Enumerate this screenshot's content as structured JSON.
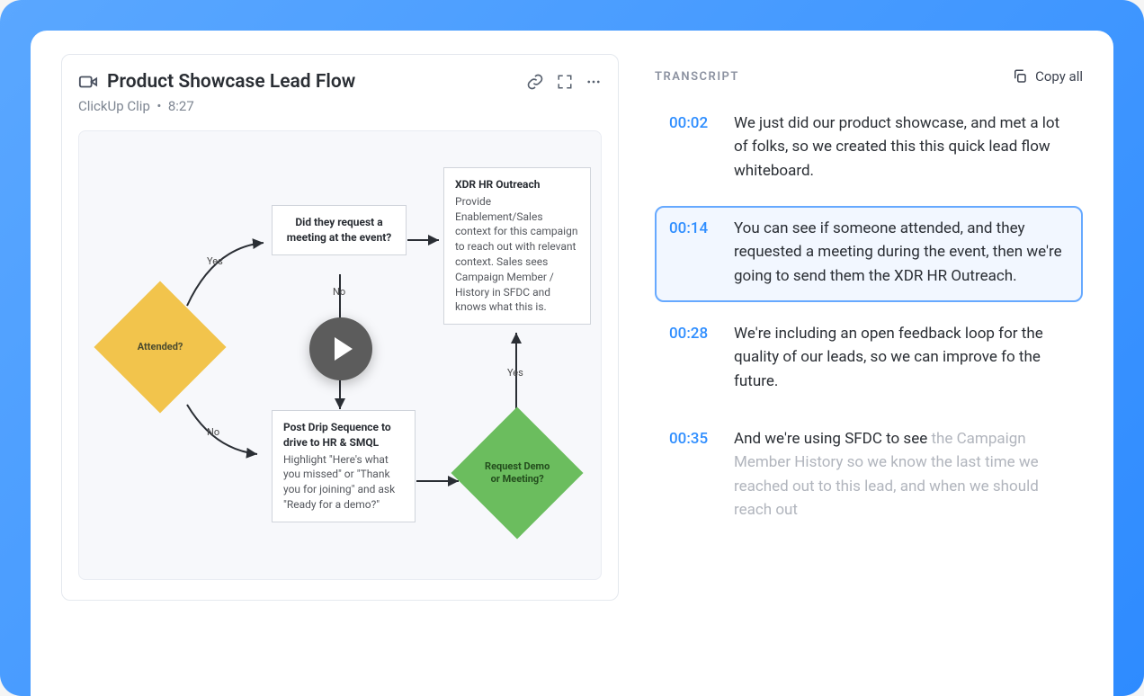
{
  "clip": {
    "title": "Product Showcase Lead Flow",
    "source": "ClickUp Clip",
    "duration": "8:27"
  },
  "flow": {
    "attended_label": "Attended?",
    "yes": "Yes",
    "no": "No",
    "meeting_box": "Did they request a meeting at the event?",
    "xdr_title": "XDR HR Outreach",
    "xdr_body": "Provide Enablement/Sales context for this campaign to reach out with relevant context. Sales sees Campaign Member / History in SFDC and knows what this is.",
    "post_drip_title": "Post Drip Sequence to drive to HR & SMQL",
    "post_drip_body": "Highlight \"Here's what you missed\" or \"Thank you for joining\" and ask \"Ready for a demo?\"",
    "request_demo_label": "Request Demo or Meeting?"
  },
  "transcript": {
    "header": "TRANSCRIPT",
    "copy_all": "Copy all",
    "segments": [
      {
        "time": "00:02",
        "text": "We just did our product showcase, and met a lot of folks, so we created this this quick lead flow whiteboard.",
        "active": false
      },
      {
        "time": "00:14",
        "text": "You can see if someone attended, and they requested a meeting during the event, then we're going to send them the XDR HR Outreach.",
        "active": true
      },
      {
        "time": "00:28",
        "text": "We're including an open feedback loop for the quality of our leads, so we can improve fo the future.",
        "active": false
      },
      {
        "time": "00:35",
        "text_head": "And we're using SFDC to see ",
        "text_tail": "the Campaign Member History so we know the last time we reached out to this lead, and when we should reach out",
        "active": false,
        "partial": true
      }
    ]
  }
}
